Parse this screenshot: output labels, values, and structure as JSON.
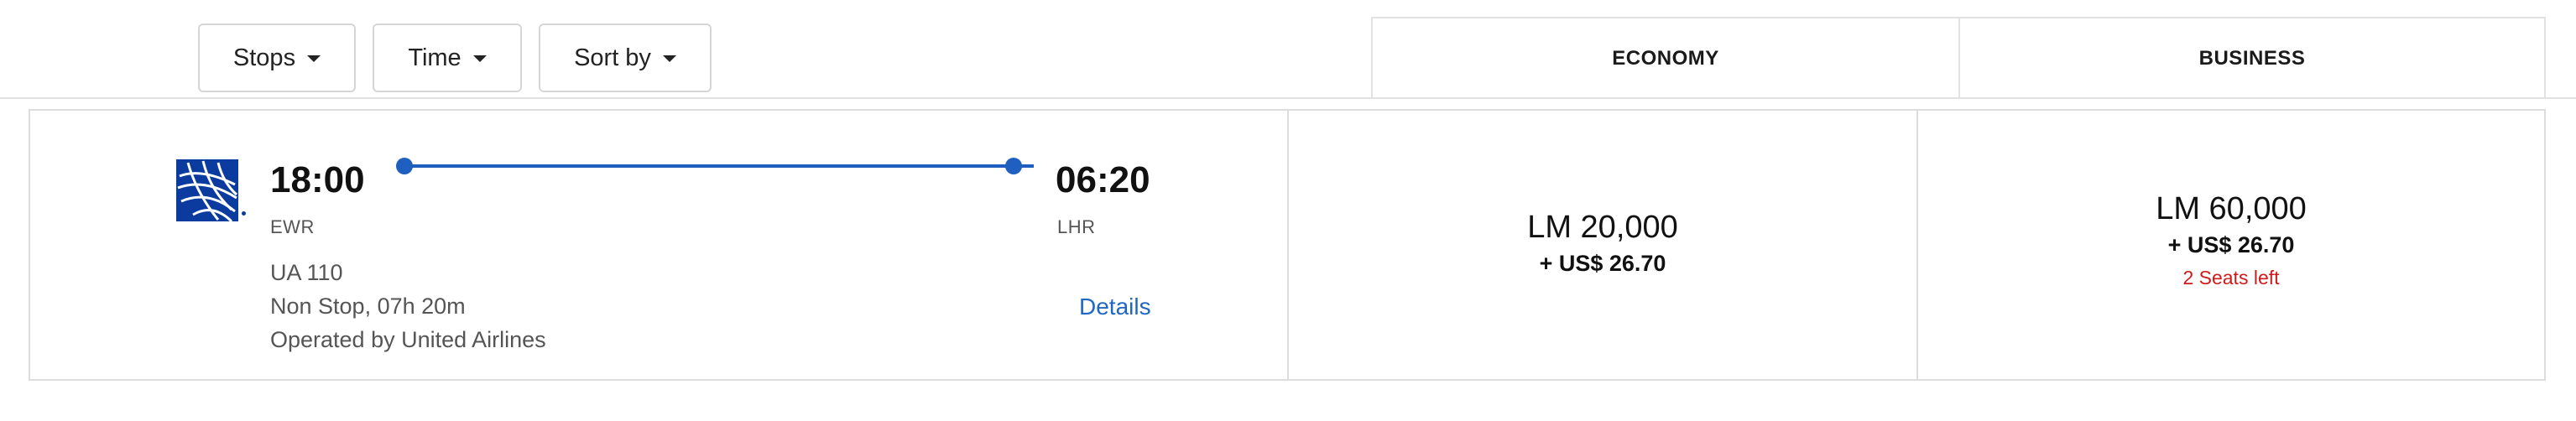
{
  "filters": {
    "stops_label": "Stops",
    "time_label": "Time",
    "sort_label": "Sort by"
  },
  "cabins": {
    "economy_label": "ECONOMY",
    "business_label": "BUSINESS"
  },
  "flight": {
    "departure_time": "18:00",
    "departure_airport": "EWR",
    "arrival_time": "06:20",
    "arrival_airport": "LHR",
    "flight_number": "UA 110",
    "duration": "Non Stop, 07h 20m",
    "operator": "Operated by United Airlines",
    "details_label": "Details",
    "airline_logo": "united-airlines-globe-icon"
  },
  "prices": {
    "economy": {
      "miles": "LM 20,000",
      "fee": "+ US$ 26.70"
    },
    "business": {
      "miles": "LM 60,000",
      "fee": "+ US$ 26.70",
      "seats_left": "2 Seats left"
    }
  },
  "colors": {
    "accent_blue": "#1f5fbf",
    "link_blue": "#1f67c0",
    "alert_red": "#d11a1a",
    "logo_blue": "#0b3b9e"
  }
}
